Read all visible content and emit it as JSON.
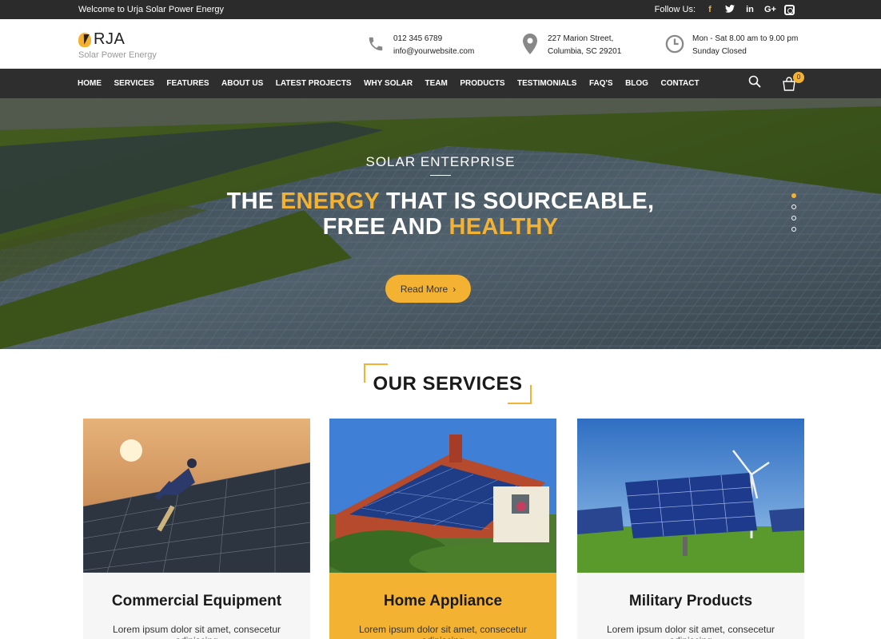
{
  "topbar": {
    "welcome": "Welcome to Urja Solar Power Energy",
    "follow_label": "Follow Us:",
    "social": [
      "f",
      "t",
      "in",
      "G+",
      "instagram-icon"
    ]
  },
  "brand": {
    "name": "RJA",
    "tagline": "Solar Power Energy"
  },
  "contact": {
    "phone": "012 345 6789",
    "email": "info@yourwebsite.com",
    "address_line1": "227 Marion Street,",
    "address_line2": "Columbia, SC 29201",
    "hours_line1": "Mon - Sat 8.00 am to 9.00 pm",
    "hours_line2": "Sunday Closed"
  },
  "nav": {
    "items": [
      "HOME",
      "SERVICES",
      "FEATURES",
      "ABOUT US",
      "LATEST PROJECTS",
      "WHY SOLAR",
      "TEAM",
      "PRODUCTS",
      "TESTIMONIALS",
      "FAQ'S",
      "BLOG",
      "CONTACT"
    ],
    "cart_count": "0"
  },
  "hero": {
    "kicker": "SOLAR ENTERPRISE",
    "line1_a": "THE ",
    "line1_b": "ENERGY",
    "line1_c": " THAT IS SOURCEABLE,",
    "line2_a": "FREE AND ",
    "line2_b": "HEALTHY",
    "button": "Read More",
    "button_arrow": "›",
    "slide_count": 4,
    "active_slide": 1
  },
  "services": {
    "title": "OUR SERVICES",
    "cards": [
      {
        "title": "Commercial Equipment",
        "text": "Lorem ipsum dolor sit amet, consecetur adipiscing"
      },
      {
        "title": "Home Appliance",
        "text": "Lorem ipsum dolor sit amet, consecetur adipiscing"
      },
      {
        "title": "Military Products",
        "text": "Lorem ipsum dolor sit amet, consecetur adipiscing"
      }
    ]
  },
  "colors": {
    "accent": "#f4b233",
    "dark": "#2e2e2e"
  }
}
